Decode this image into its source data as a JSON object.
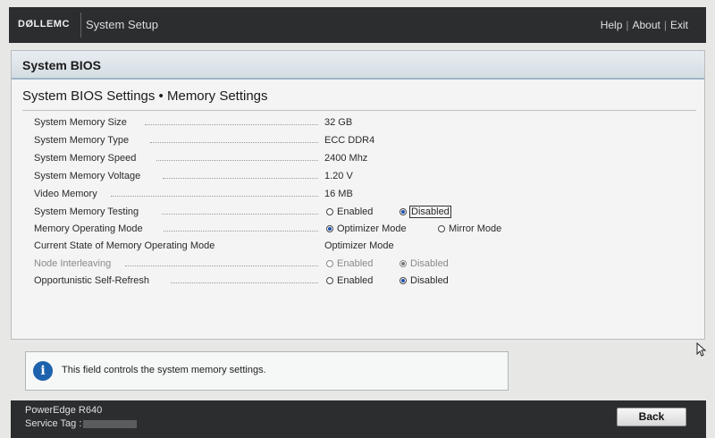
{
  "topbar": {
    "logo": "DØLLEMC",
    "app_title": "System Setup",
    "links": [
      "Help",
      "About",
      "Exit"
    ]
  },
  "panel": {
    "title": "System BIOS",
    "subtitle": "System BIOS Settings • Memory Settings"
  },
  "settings": [
    {
      "label": "System Memory Size",
      "value": "32 GB"
    },
    {
      "label": "System Memory Type",
      "value": "ECC DDR4"
    },
    {
      "label": "System Memory Speed",
      "value": "2400 Mhz"
    },
    {
      "label": "System Memory Voltage",
      "value": "1.20 V"
    },
    {
      "label": "Video Memory",
      "value": "16 MB"
    },
    {
      "label": "System Memory Testing",
      "options": [
        "Enabled",
        "Disabled"
      ],
      "selected": "Disabled"
    },
    {
      "label": "Memory Operating Mode",
      "options": [
        "Optimizer Mode",
        "Mirror Mode"
      ],
      "selected": "Optimizer Mode"
    },
    {
      "label": "Current State of Memory Operating Mode",
      "value": "Optimizer Mode"
    },
    {
      "label": "Node Interleaving",
      "options": [
        "Enabled",
        "Disabled"
      ],
      "selected": "Disabled",
      "disabled": true
    },
    {
      "label": "Opportunistic Self-Refresh",
      "options": [
        "Enabled",
        "Disabled"
      ],
      "selected": "Disabled"
    }
  ],
  "help_text": "This field controls the system memory settings.",
  "footer": {
    "model": "PowerEdge R640",
    "service_tag_label": "Service Tag :",
    "back_label": "Back"
  }
}
